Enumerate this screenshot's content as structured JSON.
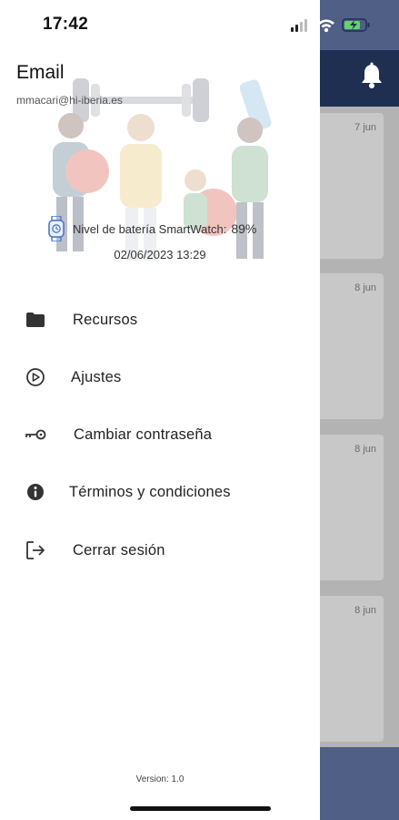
{
  "status_bar": {
    "time": "17:42"
  },
  "drawer": {
    "email_title": "Email",
    "email_value": "mmacari@hi-iberia.es",
    "battery_label": "Nivel de batería SmartWatch:",
    "battery_value": "89%",
    "timestamp": "02/06/2023 13:29",
    "menu": [
      {
        "label": "Recursos",
        "icon": "folder-icon"
      },
      {
        "label": "Ajustes",
        "icon": "settings-play-icon"
      },
      {
        "label": "Cambiar contraseña",
        "icon": "key-icon"
      },
      {
        "label": "Términos y condiciones",
        "icon": "info-icon"
      },
      {
        "label": "Cerrar sesión",
        "icon": "logout-icon"
      }
    ],
    "version": "Version: 1.0"
  },
  "background": {
    "cards": [
      {
        "date": "7 jun"
      },
      {
        "date": "8 jun"
      },
      {
        "date": "8 jun"
      },
      {
        "date": "8 jun"
      }
    ]
  },
  "colors": {
    "header": "#1f2f52",
    "status": "#4f5f86",
    "watch_icon": "#4b78c8"
  }
}
